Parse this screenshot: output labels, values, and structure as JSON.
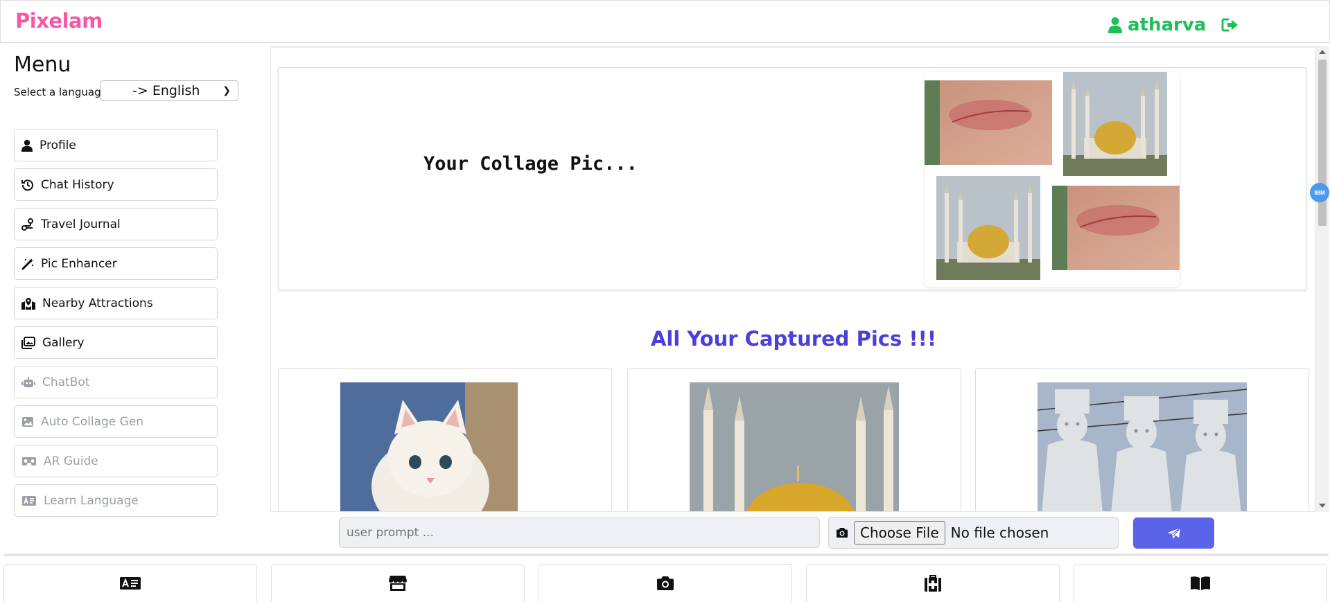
{
  "app": {
    "brand": "Pixelam"
  },
  "header": {
    "username": "atharva"
  },
  "sidebar": {
    "title": "Menu",
    "language_label": "Select a language:",
    "language_selected": "-> English",
    "items": [
      {
        "label": "Profile",
        "icon": "user-icon",
        "enabled": true
      },
      {
        "label": "Chat History",
        "icon": "history-icon",
        "enabled": true
      },
      {
        "label": "Travel Journal",
        "icon": "route-icon",
        "enabled": true
      },
      {
        "label": "Pic Enhancer",
        "icon": "magic-wand-icon",
        "enabled": true
      },
      {
        "label": "Nearby Attractions",
        "icon": "map-location-icon",
        "enabled": true
      },
      {
        "label": "Gallery",
        "icon": "images-icon",
        "enabled": true
      },
      {
        "label": "ChatBot",
        "icon": "robot-icon",
        "enabled": false
      },
      {
        "label": "Auto Collage Gen",
        "icon": "image-icon",
        "enabled": false
      },
      {
        "label": "AR Guide",
        "icon": "vr-headset-icon",
        "enabled": false
      },
      {
        "label": "Learn Language",
        "icon": "language-card-icon",
        "enabled": false
      }
    ]
  },
  "main": {
    "collage_text": "Your Collage Pic...",
    "section_title": "All Your Captured Pics !!!",
    "badge": "88M"
  },
  "composer": {
    "prompt_placeholder": "user prompt ...",
    "choose_file_label": "Choose File",
    "file_status": "No file chosen"
  },
  "bottom_nav": [
    {
      "icon": "language-card-icon"
    },
    {
      "icon": "store-icon"
    },
    {
      "icon": "camera-icon"
    },
    {
      "icon": "medical-kit-icon"
    },
    {
      "icon": "book-open-icon"
    }
  ],
  "colors": {
    "brand": "#f25aa5",
    "user": "#1fbf57",
    "section_title": "#4a3fd9",
    "send_button": "#5b63e8",
    "disabled_text": "#9aa0a6"
  }
}
